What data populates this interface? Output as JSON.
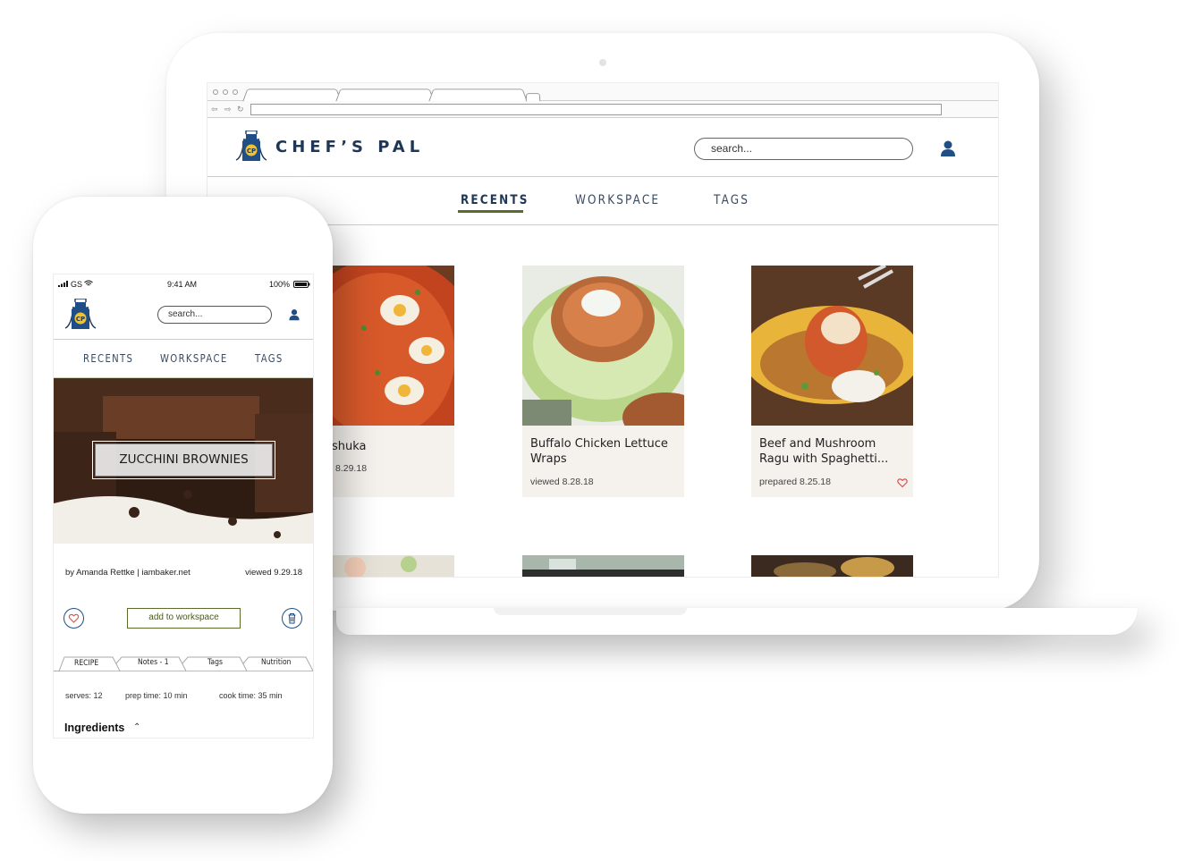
{
  "laptop": {
    "brand": {
      "logo_text": "CP",
      "name": "CHEF’S PAL"
    },
    "search": {
      "placeholder": "search..."
    },
    "nav": [
      {
        "label": "RECENTS",
        "active": true
      },
      {
        "label": "WORKSPACE",
        "active": false
      },
      {
        "label": "TAGS",
        "active": false
      }
    ],
    "cards": [
      {
        "title": "shuka",
        "meta": "8.29.18",
        "favorited": false
      },
      {
        "title": "Buffalo Chicken Lettuce Wraps",
        "meta": "viewed 8.28.18",
        "favorited": false
      },
      {
        "title": "Beef and Mushroom Ragu with Spaghetti...",
        "meta": "prepared 8.25.18",
        "favorited": true
      }
    ]
  },
  "phone": {
    "status": {
      "carrier": "GS",
      "time": "9:41 AM",
      "battery": "100%"
    },
    "logo_text": "CP",
    "search": {
      "placeholder": "search..."
    },
    "nav": [
      {
        "label": "RECENTS"
      },
      {
        "label": "WORKSPACE"
      },
      {
        "label": "TAGS"
      }
    ],
    "recipe": {
      "title": "ZUCCHINI BROWNIES",
      "byline": "by Amanda Rettke | iambaker.net",
      "viewed": "viewed 9.29.18",
      "add_button": "add to workspace"
    },
    "tabs": [
      {
        "label": "RECIPE",
        "active": true
      },
      {
        "label": "Notes - 1",
        "active": false
      },
      {
        "label": "Tags",
        "active": false
      },
      {
        "label": "Nutrition",
        "active": false
      }
    ],
    "details": {
      "serves": "serves: 12",
      "prep": "prep time: 10 min",
      "cook": "cook time: 35 min"
    },
    "ingredients_label": "Ingredients"
  },
  "colors": {
    "brand_navy": "#1f3756",
    "accent_olive": "#5b6b2a",
    "icon_blue": "#1f4f86",
    "heart_red": "#d9534f",
    "apron_yellow": "#f2c12e"
  }
}
